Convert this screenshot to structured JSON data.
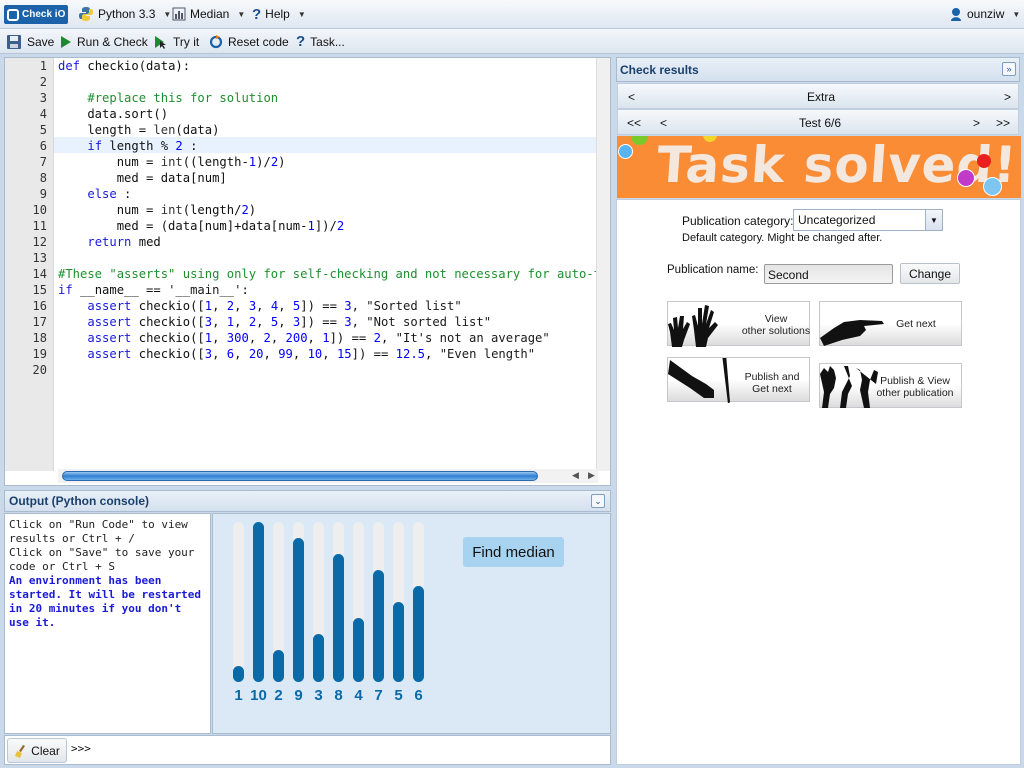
{
  "menubar": {
    "logo": "Check iO",
    "language": "Python 3.3",
    "task": "Median",
    "help": "Help",
    "user": "ounziw"
  },
  "toolbar": {
    "save": "Save",
    "run_check": "Run & Check",
    "try_it": "Try it",
    "reset_code": "Reset code",
    "task": "Task..."
  },
  "editor": {
    "line_numbers": [
      "1",
      "2",
      "3",
      "4",
      "5",
      "6",
      "7",
      "8",
      "9",
      "10",
      "11",
      "12",
      "13",
      "14",
      "15",
      "16",
      "17",
      "18",
      "19",
      "20"
    ],
    "lines": [
      "def checkio(data):",
      "",
      "    #replace this for solution",
      "    data.sort()",
      "    length = len(data)",
      "    if length % 2 :",
      "        num = int((length-1)/2)",
      "        med = data[num]",
      "    else :",
      "        num = int(length/2)",
      "        med = (data[num]+data[num-1])/2",
      "    return med",
      "",
      "#These \"asserts\" using only for self-checking and not necessary for auto-testing",
      "if __name__ == '__main__':",
      "    assert checkio([1, 2, 3, 4, 5]) == 3, \"Sorted list\"",
      "    assert checkio([3, 1, 2, 5, 3]) == 3, \"Not sorted list\"",
      "    assert checkio([1, 300, 2, 200, 1]) == 2, \"It's not an average\"",
      "    assert checkio([3, 6, 20, 99, 10, 15]) == 12.5, \"Even length\"",
      ""
    ]
  },
  "output": {
    "title": "Output (Python console)",
    "console": {
      "hint_run": "Click on \"Run Code\" to view results or Ctrl + /",
      "hint_save": "Click on \"Save\" to save your code or Ctrl + S",
      "env_notice": "An environment has been started. It will be restarted in 20 minutes if you don't use it."
    },
    "find_median_label": "Find median",
    "clear": "Clear",
    "prompt": ">>>"
  },
  "chart_data": {
    "type": "bar",
    "categories": [
      "1",
      "10",
      "2",
      "9",
      "3",
      "8",
      "4",
      "7",
      "5",
      "6"
    ],
    "values": [
      1,
      10,
      2,
      9,
      3,
      8,
      4,
      7,
      5,
      6
    ],
    "ylim": [
      0,
      10
    ],
    "bar_color": "#0a6aa8",
    "track_color": "#eeeeee"
  },
  "results": {
    "title": "Check results",
    "extra_nav": {
      "prev": "<",
      "label": "Extra",
      "next": ">"
    },
    "test_nav": {
      "first": "<<",
      "prev": "<",
      "label": "Test 6/6",
      "next": ">",
      "last": ">>"
    },
    "banner": "Task solved!",
    "publication_category_label": "Publication category:",
    "publication_category_value": "Uncategorized",
    "category_note": "Default category. Might be changed after.",
    "publication_name_label": "Publication name:",
    "publication_name_value": "Second",
    "change": "Change",
    "actions": {
      "view_other": [
        "View",
        "other solutions"
      ],
      "get_next": "Get next",
      "publish_get_next": [
        "Publish and",
        "Get next"
      ],
      "publish_view": [
        "Publish & View",
        "other publication"
      ]
    }
  },
  "colors": {
    "accent": "#1b62a8",
    "banner": "#fa8c36",
    "keyword": "#1a1ad8",
    "comment": "#1f8f2f",
    "string": "#1a1a1a",
    "number": "#0000ff",
    "find_median_button": "#a8d3f0"
  }
}
